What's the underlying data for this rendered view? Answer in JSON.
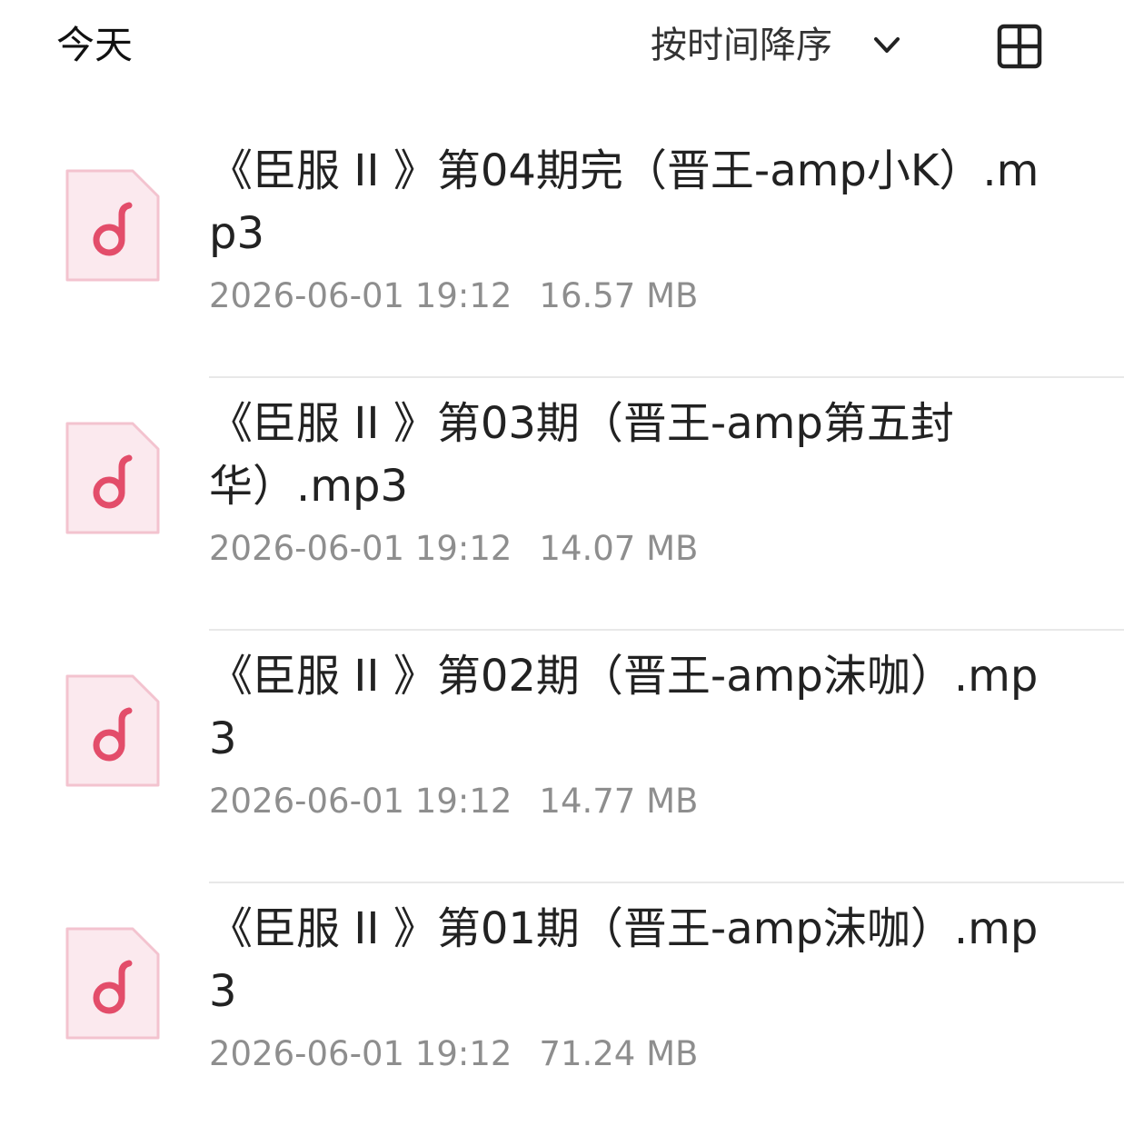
{
  "header": {
    "section_title": "今天",
    "sort_label": "按时间降序",
    "chevron_icon": "chevron-down-icon",
    "view_toggle_icon": "grid-view-icon"
  },
  "files": [
    {
      "name": "《臣服 II 》第04期完（晋王-amp小K）.mp3",
      "date": "2026-06-01 19:12",
      "size": "16.57 MB",
      "icon": "music-file-icon"
    },
    {
      "name": "《臣服 II 》第03期（晋王-amp第五封华）.mp3",
      "date": "2026-06-01 19:12",
      "size": "14.07 MB",
      "icon": "music-file-icon"
    },
    {
      "name": "《臣服 II 》第02期（晋王-amp沫咖）.mp3",
      "date": "2026-06-01 19:12",
      "size": "14.77 MB",
      "icon": "music-file-icon"
    },
    {
      "name": "《臣服 II 》第01期（晋王-amp沫咖）.mp3",
      "date": "2026-06-01 19:12",
      "size": "71.24 MB",
      "icon": "music-file-icon"
    }
  ],
  "colors": {
    "icon_fill": "#fbe9ee",
    "icon_stroke": "#f3c3cf",
    "icon_accent": "#e34d6a",
    "meta_text": "#8e8e8e",
    "divider": "#e8e8e8"
  }
}
